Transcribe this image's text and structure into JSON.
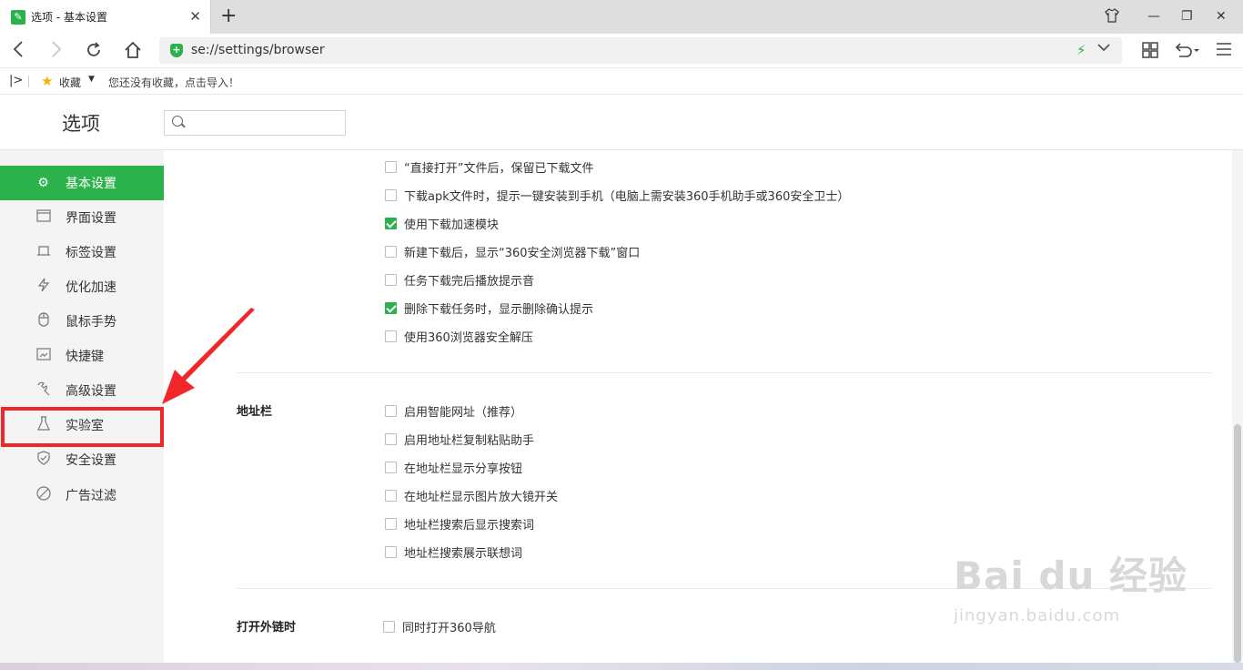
{
  "tab": {
    "favicon": "wrench-icon",
    "title": "选项 - 基本设置"
  },
  "window_controls": {
    "shirt": "skin-icon",
    "minimize": "—",
    "restore": "❐",
    "close": "✕"
  },
  "address": {
    "url": "se://settings/browser"
  },
  "bookmarks": {
    "favorites_label": "收藏",
    "empty_hint": "您还没有收藏，点击导入！"
  },
  "options": {
    "title": "选项",
    "search_placeholder": ""
  },
  "sidebar": {
    "items": [
      {
        "label": "基本设置",
        "icon": "gear-icon"
      },
      {
        "label": "界面设置",
        "icon": "window-icon"
      },
      {
        "label": "标签设置",
        "icon": "tab-icon"
      },
      {
        "label": "优化加速",
        "icon": "bolt-icon"
      },
      {
        "label": "鼠标手势",
        "icon": "mouse-icon"
      },
      {
        "label": "快捷键",
        "icon": "keyboard-icon"
      },
      {
        "label": "高级设置",
        "icon": "wrench-icon"
      },
      {
        "label": "实验室",
        "icon": "flask-icon"
      },
      {
        "label": "安全设置",
        "icon": "shield-icon"
      },
      {
        "label": "广告过滤",
        "icon": "block-icon"
      }
    ],
    "active_index": 0
  },
  "download_options": [
    {
      "label": "“直接打开”文件后，保留已下载文件",
      "checked": false
    },
    {
      "label": "下载apk文件时，提示一键安装到手机（电脑上需安装360手机助手或360安全卫士）",
      "checked": false
    },
    {
      "label": "使用下载加速模块",
      "checked": true
    },
    {
      "label": "新建下载后，显示“360安全浏览器下载”窗口",
      "checked": false
    },
    {
      "label": "任务下载完后播放提示音",
      "checked": false
    },
    {
      "label": "删除下载任务时，显示删除确认提示",
      "checked": true
    },
    {
      "label": "使用360浏览器安全解压",
      "checked": false
    }
  ],
  "address_bar_section": {
    "title": "地址栏",
    "options": [
      {
        "label": "启用智能网址（推荐）",
        "checked": false
      },
      {
        "label": "启用地址栏复制粘贴助手",
        "checked": false
      },
      {
        "label": "在地址栏显示分享按钮",
        "checked": false
      },
      {
        "label": "在地址栏显示图片放大镜开关",
        "checked": false
      },
      {
        "label": "地址栏搜索后显示搜索词",
        "checked": false
      },
      {
        "label": "地址栏搜索展示联想词",
        "checked": false
      }
    ]
  },
  "external_link_section": {
    "title": "打开外链时",
    "options": [
      {
        "label": "同时打开360导航",
        "checked": false
      }
    ]
  },
  "watermark": {
    "main": "Bai du 经验",
    "sub": "jingyan.baidu.com"
  },
  "colors": {
    "accent": "#2bb24c",
    "highlight": "#f0272a"
  }
}
